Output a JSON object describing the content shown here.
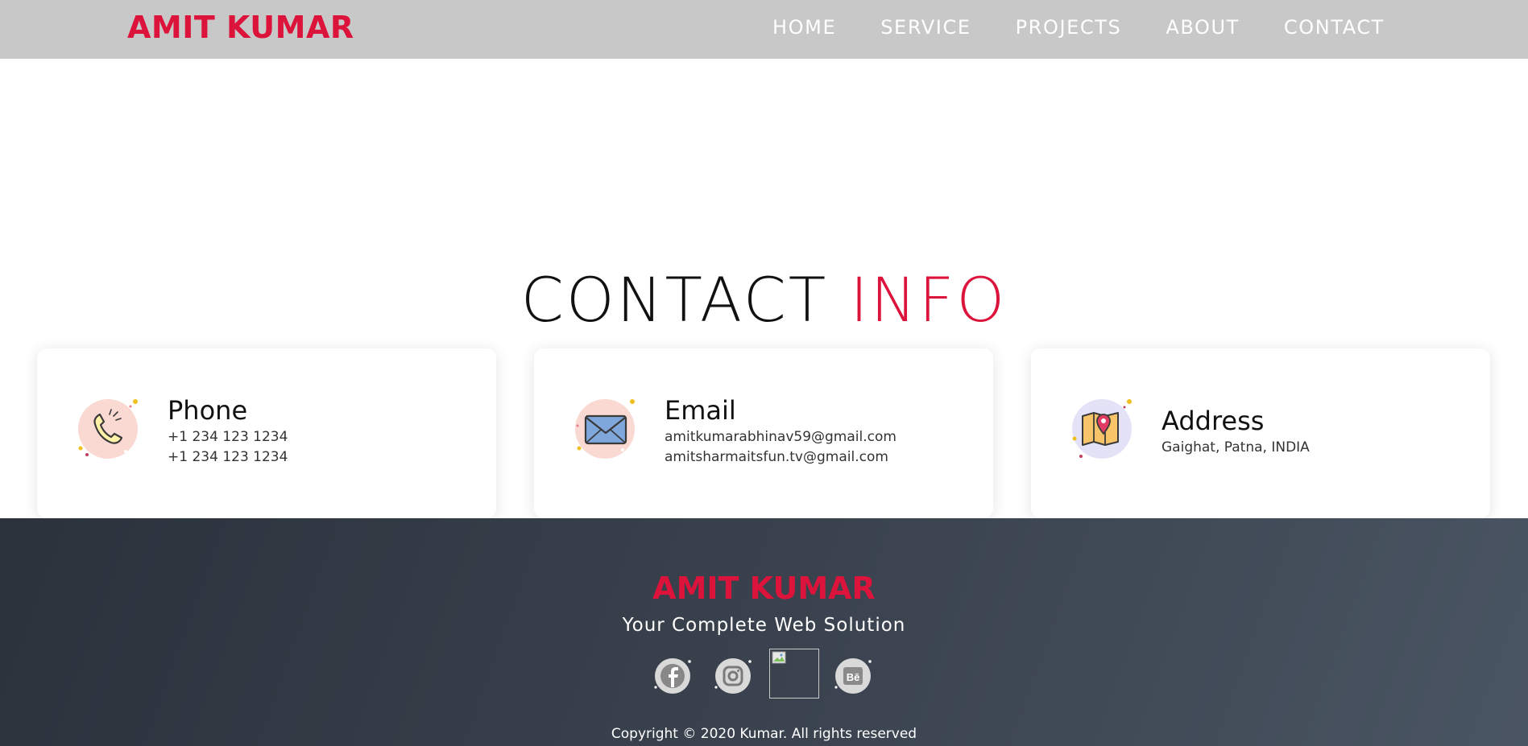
{
  "header": {
    "brand": "AMIT KUMAR",
    "nav": [
      "HOME",
      "SERVICE",
      "PROJECTS",
      "ABOUT",
      "CONTACT"
    ]
  },
  "section": {
    "title_part1": "CONTACT",
    "title_part2": "INFO"
  },
  "cards": [
    {
      "icon": "phone-icon",
      "title": "Phone",
      "lines": [
        "+1 234 123 1234",
        "+1 234 123 1234"
      ]
    },
    {
      "icon": "envelope-icon",
      "title": "Email",
      "lines": [
        "amitkumarabhinav59@gmail.com",
        "amitsharmaitsfun.tv@gmail.com"
      ]
    },
    {
      "icon": "map-pin-icon",
      "title": "Address",
      "lines": [
        "Gaighat, Patna, INDIA"
      ]
    }
  ],
  "footer": {
    "brand": "AMIT KUMAR",
    "tagline": "Your Complete Web Solution",
    "socials": [
      "facebook-icon",
      "instagram-icon",
      "broken-image-icon",
      "behance-icon"
    ],
    "copyright": "Copyright © 2020 Kumar. All rights reserved"
  },
  "colors": {
    "accent": "#dc143c",
    "header_bg": "#c8c8c8",
    "footer_bg": "#333b46"
  }
}
